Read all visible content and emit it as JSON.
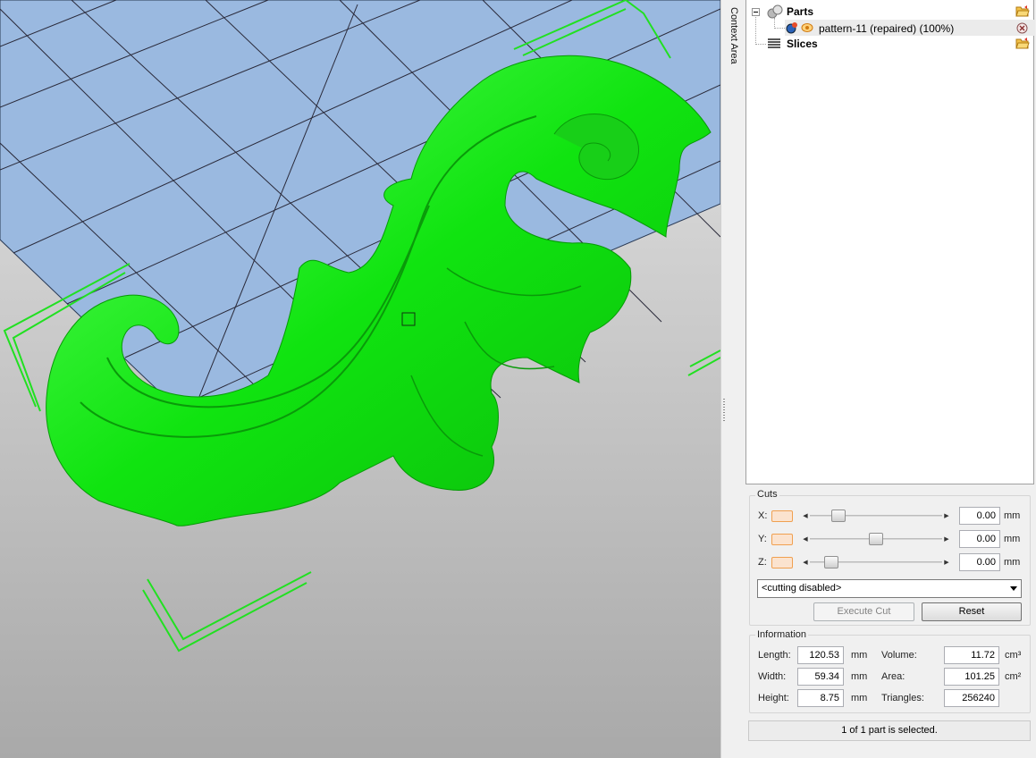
{
  "context_tab": {
    "label": "Context Area"
  },
  "tree": {
    "parts_label": "Parts",
    "part_item_label": "pattern-11 (repaired) (100%)",
    "slices_label": "Slices"
  },
  "cuts": {
    "title": "Cuts",
    "axes": [
      {
        "label": "X:",
        "value": "0.00",
        "unit": "mm",
        "slider_fraction": 0.18
      },
      {
        "label": "Y:",
        "value": "0.00",
        "unit": "mm",
        "slider_fraction": 0.5
      },
      {
        "label": "Z:",
        "value": "0.00",
        "unit": "mm",
        "slider_fraction": 0.12
      }
    ],
    "mode_selected": "<cutting disabled>",
    "execute_label": "Execute Cut",
    "reset_label": "Reset"
  },
  "information": {
    "title": "Information",
    "length_label": "Length:",
    "length_value": "120.53",
    "length_unit": "mm",
    "width_label": "Width:",
    "width_value": "59.34",
    "width_unit": "mm",
    "height_label": "Height:",
    "height_value": "8.75",
    "height_unit": "mm",
    "volume_label": "Volume:",
    "volume_value": "11.72",
    "volume_unit": "cm³",
    "area_label": "Area:",
    "area_value": "101.25",
    "area_unit": "cm²",
    "triangles_label": "Triangles:",
    "triangles_value": "256240"
  },
  "status_text": "1 of 1 part is selected.",
  "colors": {
    "model": "#1fe81f",
    "platform": "#9ab9e0",
    "selection": "#21e021",
    "accent": "#f0a050"
  }
}
